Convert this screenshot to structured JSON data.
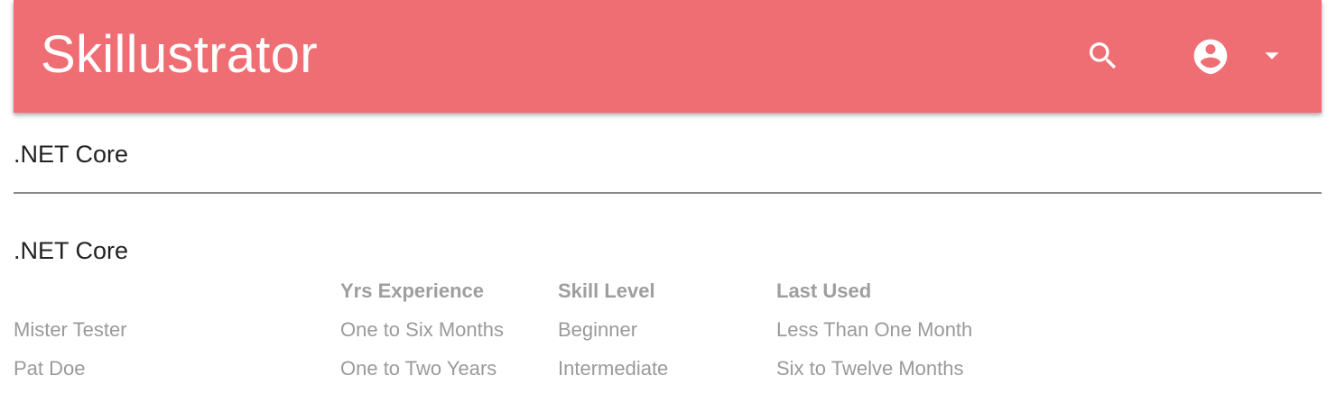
{
  "app": {
    "title": "Skillustrator",
    "accent_color": "#ef6e74"
  },
  "toolbar": {
    "search_icon": "search-icon",
    "account_icon": "account-circle-icon",
    "dropdown_icon": "arrow-drop-down-icon"
  },
  "page": {
    "title": ".NET Core"
  },
  "skill_section": {
    "title": ".NET Core",
    "columns": [
      "",
      "Yrs Experience",
      "Skill Level",
      "Last Used"
    ],
    "rows": [
      {
        "name": "Mister Tester",
        "experience": "One to Six Months",
        "level": "Beginner",
        "last_used": "Less Than One Month"
      },
      {
        "name": "Pat Doe",
        "experience": "One to Two Years",
        "level": "Intermediate",
        "last_used": "Six to Twelve Months"
      }
    ]
  }
}
